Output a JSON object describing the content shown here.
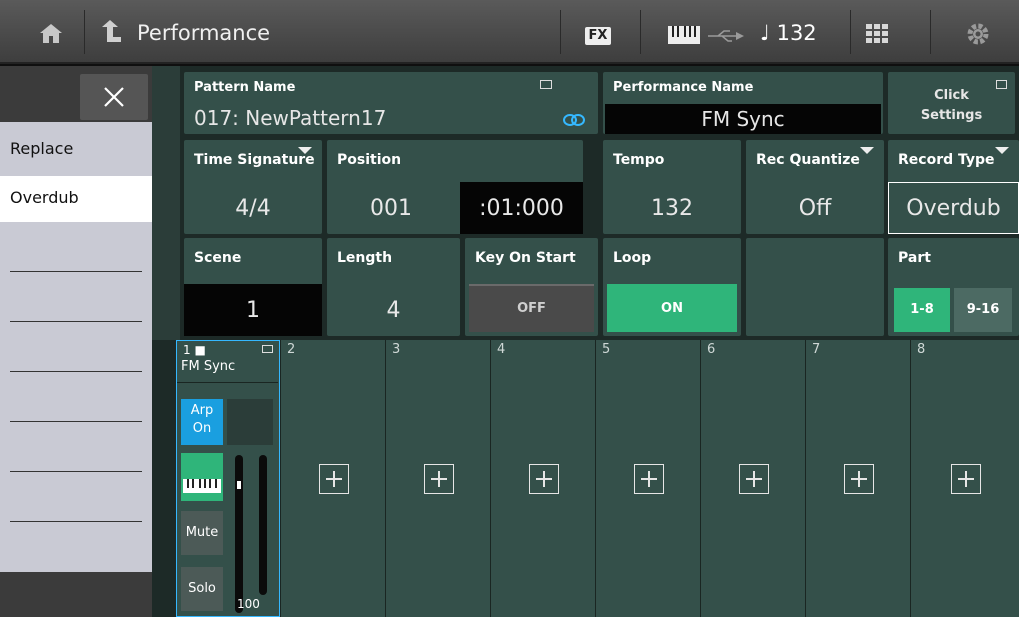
{
  "topbar": {
    "title": "Performance",
    "fx_label": "FX",
    "tempo": "♩ 132"
  },
  "pattern": {
    "label": "Pattern Name",
    "value": "017: NewPattern17"
  },
  "performance": {
    "label": "Performance Name",
    "value": "FM Sync"
  },
  "click": {
    "label": "Click\nSettings"
  },
  "time_signature": {
    "label": "Time Signature",
    "value": "4/4"
  },
  "position": {
    "label": "Position",
    "measure": "001",
    "beat": ":01:000"
  },
  "tempo": {
    "label": "Tempo",
    "value": "132"
  },
  "rec_quantize": {
    "label": "Rec Quantize",
    "value": "Off"
  },
  "record_type": {
    "label": "Record Type",
    "value": "Overdub"
  },
  "scene": {
    "label": "Scene",
    "value": "1"
  },
  "length": {
    "label": "Length",
    "value": "4"
  },
  "key_on_start": {
    "label": "Key On Start",
    "value": "OFF"
  },
  "loop": {
    "label": "Loop",
    "value": "ON"
  },
  "part": {
    "label": "Part",
    "tabs": [
      "1-8",
      "9-16"
    ]
  },
  "part1": {
    "num": "1 ■",
    "name": "FM Sync",
    "arp": "Arp\nOn",
    "mute": "Mute",
    "solo": "Solo",
    "volume": "100"
  },
  "parts": [
    "2",
    "3",
    "4",
    "5",
    "6",
    "7",
    "8"
  ],
  "menu": {
    "items": [
      "Replace",
      "Overdub"
    ]
  },
  "colors": {
    "accent_green": "#2fb57a",
    "arp_blue": "#1a9fe0",
    "menu_bg": "#c9cad4"
  }
}
